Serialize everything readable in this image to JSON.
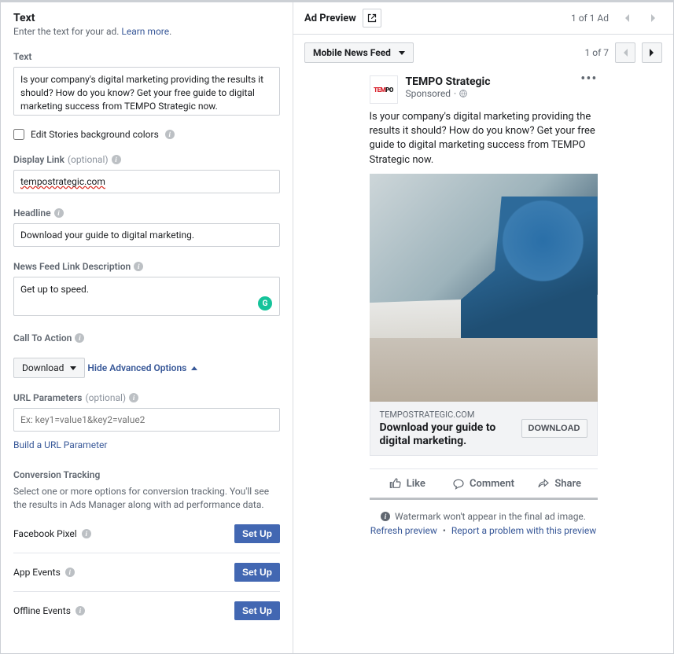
{
  "left": {
    "title": "Text",
    "subtitle": "Enter the text for your ad. ",
    "learn_more": "Learn more",
    "text_label": "Text",
    "text_value": "Is your company's digital marketing providing the results it should? How do you know? Get your free guide to digital marketing success from TEMPO Strategic now.",
    "edit_stories_label": "Edit Stories background colors",
    "display_link_label": "Display Link",
    "optional_label": "(optional)",
    "display_link_value": "tempostrategic.com",
    "headline_label": "Headline",
    "headline_value": "Download your guide to digital marketing.",
    "nf_desc_label": "News Feed Link Description",
    "nf_desc_value": "Get up to speed.",
    "cta_label": "Call To Action",
    "cta_value": "Download",
    "adv_toggle": "Hide Advanced Options",
    "url_params_label": "URL Parameters",
    "url_params_placeholder": "Ex: key1=value1&key2=value2",
    "build_url_link": "Build a URL Parameter",
    "conv_heading": "Conversion Tracking",
    "conv_desc": "Select one or more options for conversion tracking. You'll see the results in Ads Manager along with ad performance data.",
    "track_pixel": "Facebook Pixel",
    "track_appevents": "App Events",
    "track_offline": "Offline Events",
    "setup_btn": "Set Up"
  },
  "right": {
    "ad_preview_label": "Ad Preview",
    "ad_count": "1 of 1 Ad",
    "feed_selector": "Mobile News Feed",
    "page_of": "1 of 7",
    "page_name": "TEMPO Strategic",
    "sponsored": "Sponsored",
    "post_text": "Is your company's digital marketing providing the results it should? How do you know? Get your free guide to digital marketing success from TEMPO Strategic now.",
    "domain": "TEMPOSTRATEGIC.COM",
    "headline": "Download your guide to digital marketing.",
    "cta_button": "DOWNLOAD",
    "action_like": "Like",
    "action_comment": "Comment",
    "action_share": "Share",
    "watermark_note": "Watermark won't appear in the final ad image.",
    "refresh_link": "Refresh preview",
    "report_link": "Report a problem with this preview"
  }
}
